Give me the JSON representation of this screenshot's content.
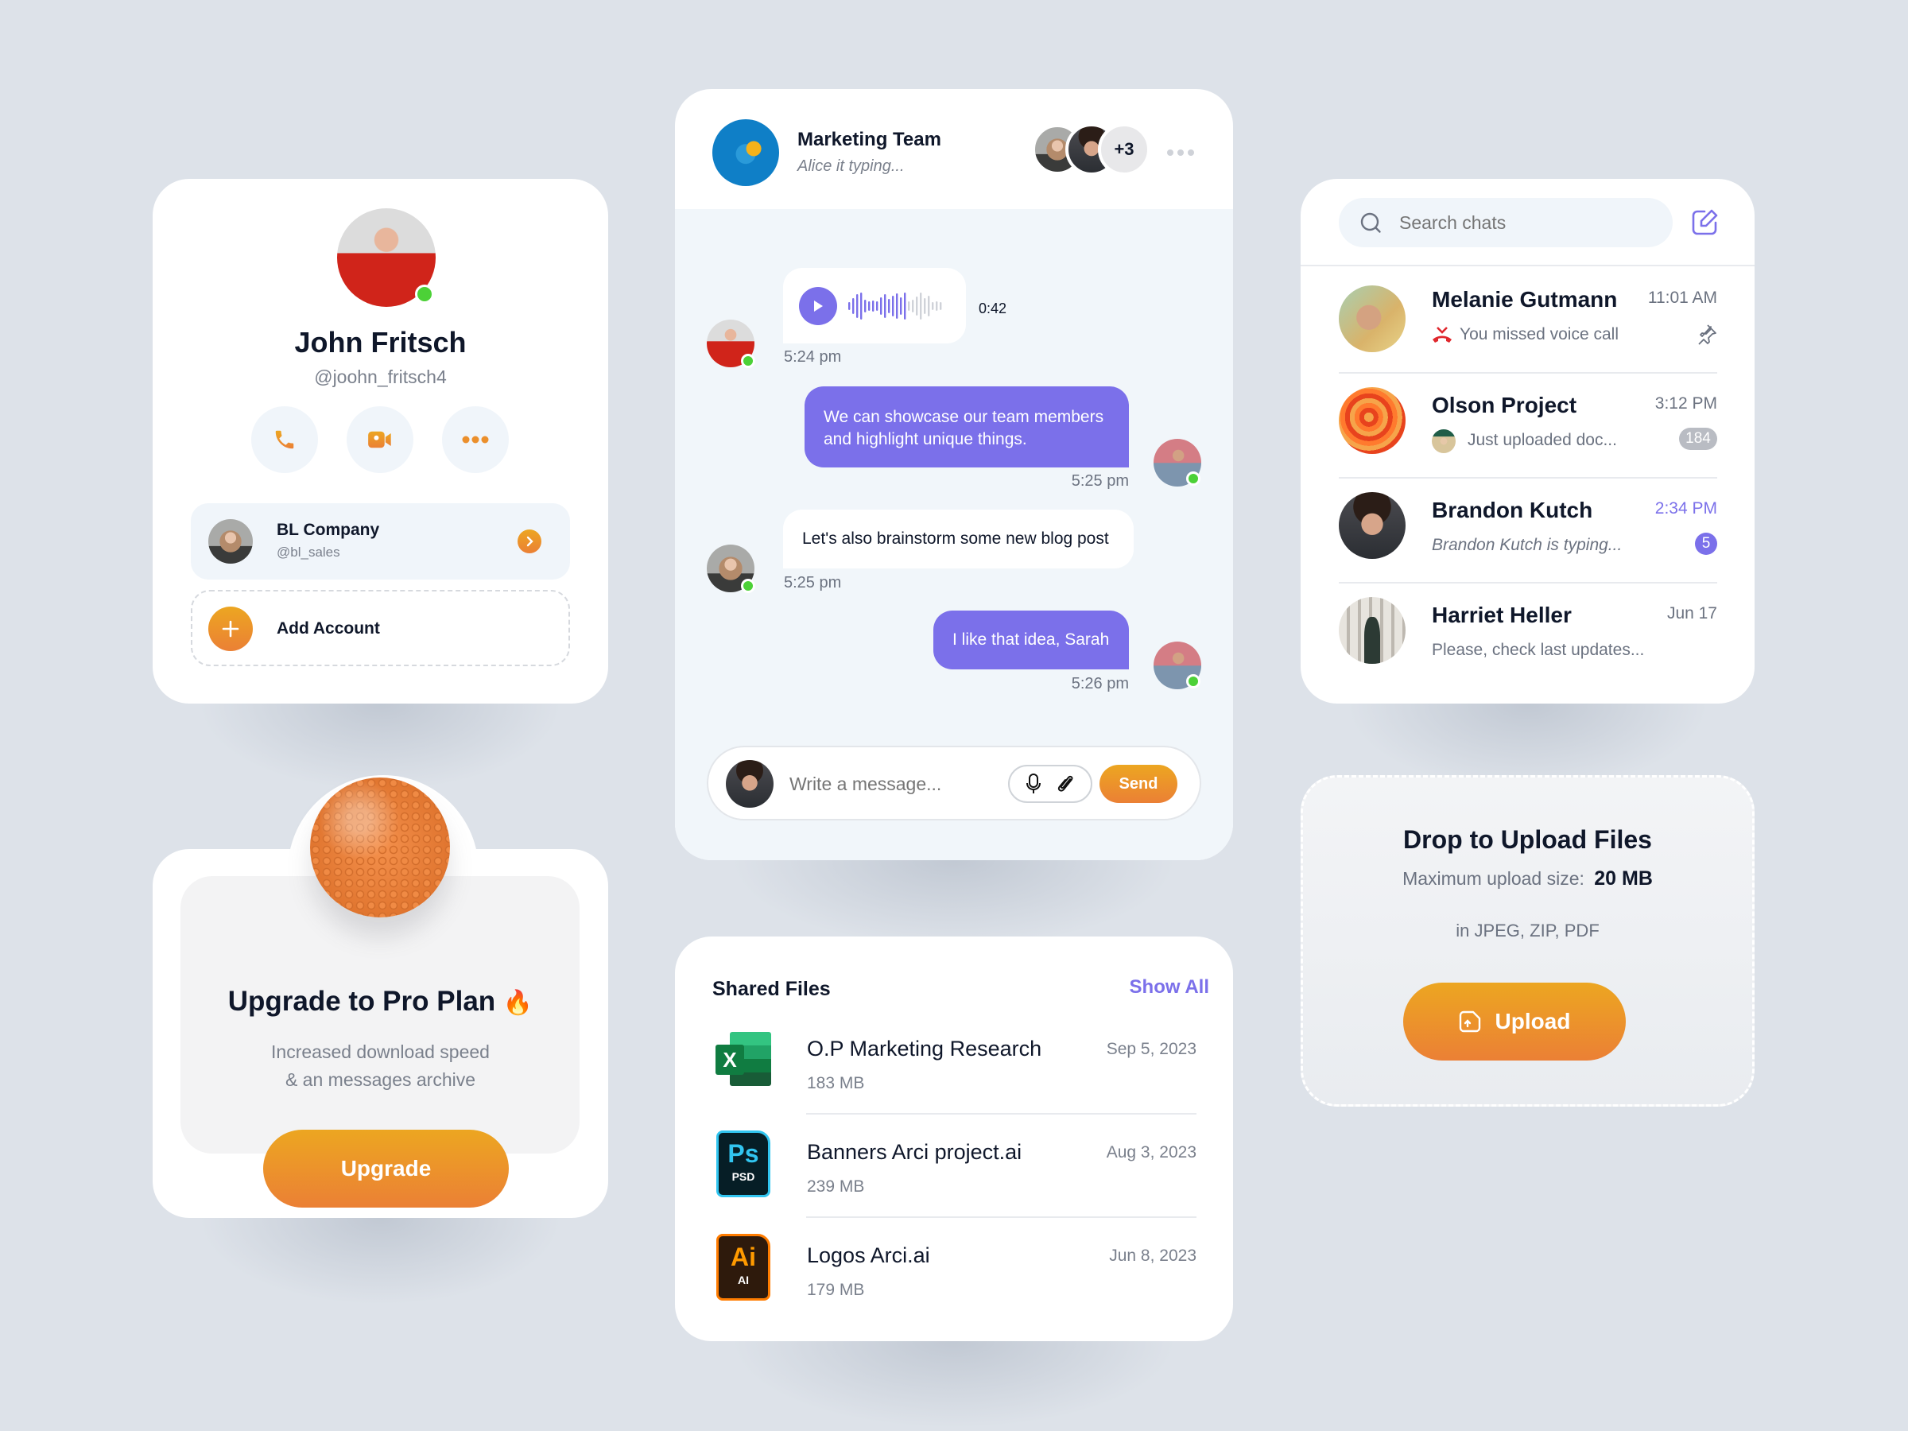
{
  "colors": {
    "accent": "#7b70ea",
    "orange_start": "#eca621",
    "orange_end": "#eb8035",
    "online": "#4cd137",
    "background": "#dde2e9"
  },
  "profile": {
    "name": "John Fritsch",
    "handle": "@joohn_fritsch4",
    "status": "online",
    "actions": [
      {
        "icon": "phone-icon",
        "label": "Call"
      },
      {
        "icon": "video-icon",
        "label": "Video call"
      },
      {
        "icon": "more-icon",
        "label": "More"
      }
    ],
    "accounts": [
      {
        "name": "BL Company",
        "handle": "@bl_sales"
      }
    ],
    "add_account_label": "Add Account"
  },
  "upgrade": {
    "title": "Upgrade to Pro Plan",
    "emoji": "🔥",
    "description_line1": "Increased download speed",
    "description_line2": "& an messages archive",
    "button_label": "Upgrade"
  },
  "chat": {
    "title": "Marketing Team",
    "subtitle": "Alice it typing...",
    "extra_members": "+3",
    "messages": [
      {
        "type": "voice",
        "direction": "in",
        "duration": "0:42",
        "played_fraction": 0.6,
        "time": "5:24 pm"
      },
      {
        "type": "text",
        "direction": "out",
        "text_line1": "We can showcase our team members",
        "text_line2": "and highlight unique things.",
        "time": "5:25 pm"
      },
      {
        "type": "text",
        "direction": "in",
        "text": "Let's also brainstorm some new blog post",
        "time": "5:25 pm"
      },
      {
        "type": "text",
        "direction": "out",
        "text": "I like that idea, Sarah",
        "time": "5:26 pm"
      }
    ],
    "composer": {
      "placeholder": "Write a message...",
      "send_label": "Send"
    }
  },
  "files": {
    "title": "Shared Files",
    "show_all_label": "Show All",
    "items": [
      {
        "name": "O.P Marketing Research",
        "size": "183 MB",
        "date": "Sep 5, 2023",
        "type": "excel",
        "icon_text": "X"
      },
      {
        "name": "Banners Arci project.ai",
        "size": "239 MB",
        "date": "Aug 3, 2023",
        "type": "psd",
        "icon_text": "Ps",
        "icon_sub": "PSD"
      },
      {
        "name": "Logos Arci.ai",
        "size": "179 MB",
        "date": "Jun 8, 2023",
        "type": "ai",
        "icon_text": "Ai",
        "icon_sub": "AI"
      }
    ]
  },
  "chat_list": {
    "search_placeholder": "Search chats",
    "items": [
      {
        "name": "Melanie Gutmann",
        "time": "11:01 AM",
        "preview": "You missed voice call",
        "pinned": true
      },
      {
        "name": "Olson Project",
        "time": "3:12 PM",
        "preview": "Just uploaded doc...",
        "badge": "184"
      },
      {
        "name": "Brandon Kutch",
        "time": "2:34 PM",
        "preview": "Brandon Kutch is typing...",
        "badge": "5"
      },
      {
        "name": "Harriet Heller",
        "time": "Jun 17",
        "preview": "Please, check last updates..."
      }
    ]
  },
  "upload": {
    "title": "Drop to Upload Files",
    "max_label": "Maximum upload size:",
    "max_value": "20 MB",
    "formats": "in JPEG, ZIP, PDF",
    "button_label": "Upload"
  }
}
